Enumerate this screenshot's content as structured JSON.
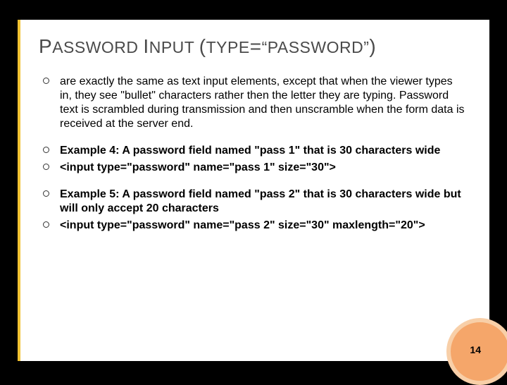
{
  "title": {
    "parts": [
      {
        "big": "P"
      },
      "ASSWORD ",
      {
        "big": "I"
      },
      "NPUT ",
      {
        "big": "("
      },
      "TYPE",
      {
        "big": "="
      },
      "“",
      "PASSWORD",
      "”",
      {
        "big": ")"
      }
    ],
    "plain": "PASSWORD INPUT (TYPE=“PASSWORD”)"
  },
  "bullets": [
    {
      "text": "are exactly the same as text input elements, except that when the viewer types in, they see \"bullet\" characters rather then the letter they are typing. Password text is scrambled during transmission and then unscramble when the form data is received at the server end.",
      "bold": false,
      "gap": false
    },
    {
      "text": "Example 4: A password field named \"pass 1\" that is 30 characters wide",
      "bold": true,
      "gap": true
    },
    {
      "text": "<input type=\"password\" name=\"pass 1\" size=\"30\">",
      "bold": true,
      "gap": false
    },
    {
      "text": "Example 5: A password field named \"pass 2\" that is 30 characters wide but will only accept 20 characters",
      "bold": true,
      "gap": true
    },
    {
      "text": "<input type=\"password\" name=\"pass 2\" size=\"30\" maxlength=\"20\">",
      "bold": true,
      "gap": false
    }
  ],
  "pageNumber": "14"
}
